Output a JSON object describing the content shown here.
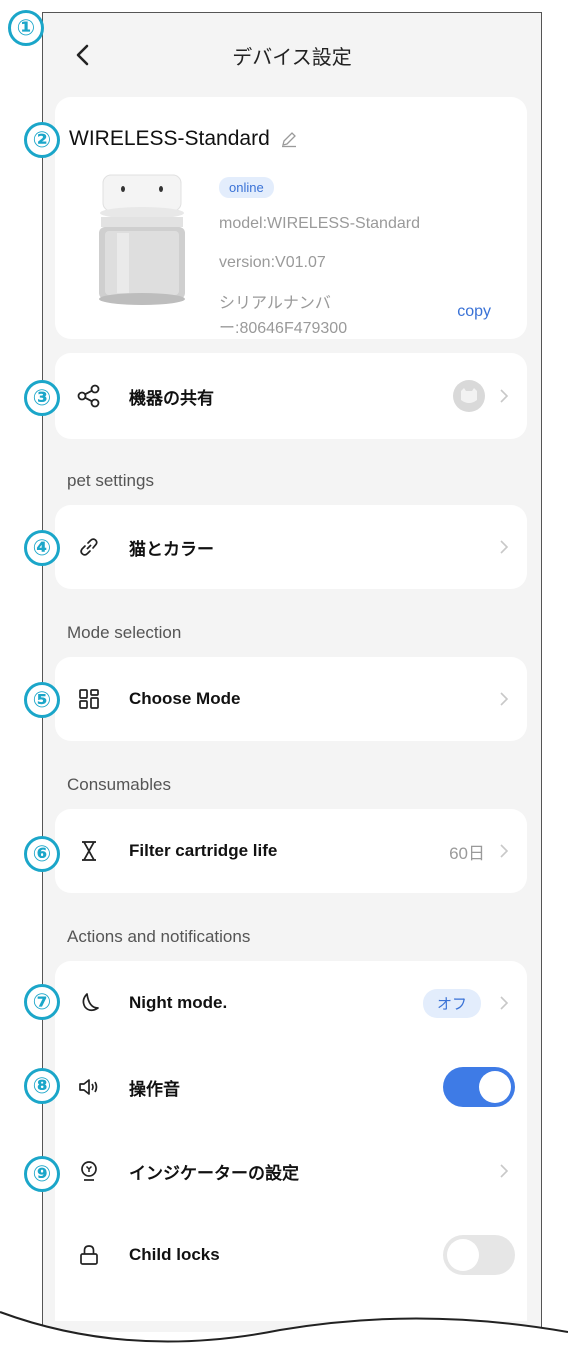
{
  "header": {
    "title": "デバイス設定"
  },
  "device": {
    "name": "WIRELESS-Standard",
    "status": "online",
    "model": "model:WIRELESS-Standard",
    "version": "version:V01.07",
    "serial": "シリアルナンバー:80646F479300",
    "copy_label": "copy"
  },
  "share": {
    "label": "機器の共有"
  },
  "sections": {
    "pet": "pet settings",
    "mode": "Mode selection",
    "consumables": "Consumables",
    "actions": "Actions and notifications"
  },
  "pet_settings": {
    "label": "猫とカラー"
  },
  "mode": {
    "label": "Choose Mode"
  },
  "filter": {
    "label": "Filter cartridge life",
    "value": "60日"
  },
  "night_mode": {
    "label": "Night mode.",
    "value": "オフ"
  },
  "sound": {
    "label": "操作音",
    "enabled": true
  },
  "indicator": {
    "label": "インジケーターの設定"
  },
  "child_lock": {
    "label": "Child locks",
    "enabled": false
  },
  "annotations": [
    "①",
    "②",
    "③",
    "④",
    "⑤",
    "⑥",
    "⑦",
    "⑧",
    "⑨"
  ],
  "colors": {
    "accent": "#3e7be6",
    "badge": "#1ba6c9",
    "background": "#f4f4f4"
  }
}
